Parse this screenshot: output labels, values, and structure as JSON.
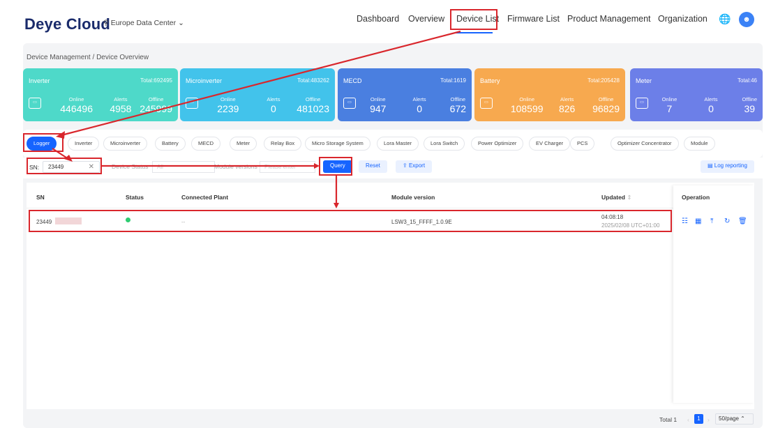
{
  "header": {
    "logo": "Deye Cloud",
    "data_center": "Europe Data Center",
    "nav": [
      "Dashboard",
      "Overview",
      "Device List",
      "Firmware List",
      "Product Management",
      "Organization"
    ],
    "globe_icon": "globe-icon",
    "avatar_icon": "avatar-icon"
  },
  "breadcrumb": {
    "part1": "Device Management",
    "sep": " / ",
    "part2": "Device Overview"
  },
  "cards": [
    {
      "title": "Inverter",
      "total": "Total:692495",
      "online": "446496",
      "alerts": "4958",
      "offline": "245999",
      "color": "#4ed9c9"
    },
    {
      "title": "Microinverter",
      "total": "Total:483262",
      "online": "2239",
      "alerts": "0",
      "offline": "481023",
      "color": "#42c3eb"
    },
    {
      "title": "MECD",
      "total": "Total:1619",
      "online": "947",
      "alerts": "0",
      "offline": "672",
      "color": "#4a7fe0"
    },
    {
      "title": "Battery",
      "total": "Total:205428",
      "online": "108599",
      "alerts": "826",
      "offline": "96829",
      "color": "#f7a94f"
    },
    {
      "title": "Meter",
      "total": "Total:46",
      "online": "7",
      "alerts": "0",
      "offline": "39",
      "color": "#6c7fe8"
    }
  ],
  "stat_labels": {
    "online": "Online",
    "alerts": "Alerts",
    "offline": "Offline"
  },
  "tabs": [
    "Logger",
    "Inverter",
    "Microinverter",
    "Battery",
    "MECD",
    "Meter",
    "Relay Box",
    "Micro Storage System",
    "Lora Master",
    "Lora Switch",
    "Power Optimizer",
    "EV Charger",
    "PCS",
    "Optimizer Concentrator",
    "Module"
  ],
  "filter": {
    "sn_label": "SN:",
    "sn_value": "23449",
    "status_label": "Device Status",
    "status_value": "All",
    "module_label": "Module versions",
    "module_placeholder": "Please enter",
    "query": "Query",
    "reset": "Reset",
    "export": "Export",
    "log_reporting": "Log reporting"
  },
  "table": {
    "headers": {
      "sn": "SN",
      "status": "Status",
      "plant": "Connected Plant",
      "module": "Module version",
      "updated": "Updated",
      "operation": "Operation"
    },
    "rows": [
      {
        "sn": "23449",
        "plant": "--",
        "module": "LSW3_15_FFFF_1.0.9E",
        "time": "04:08:18",
        "date": "2025/02/08 UTC+01:00"
      }
    ]
  },
  "pager": {
    "total": "Total 1",
    "page": "1",
    "size": "50/page"
  }
}
